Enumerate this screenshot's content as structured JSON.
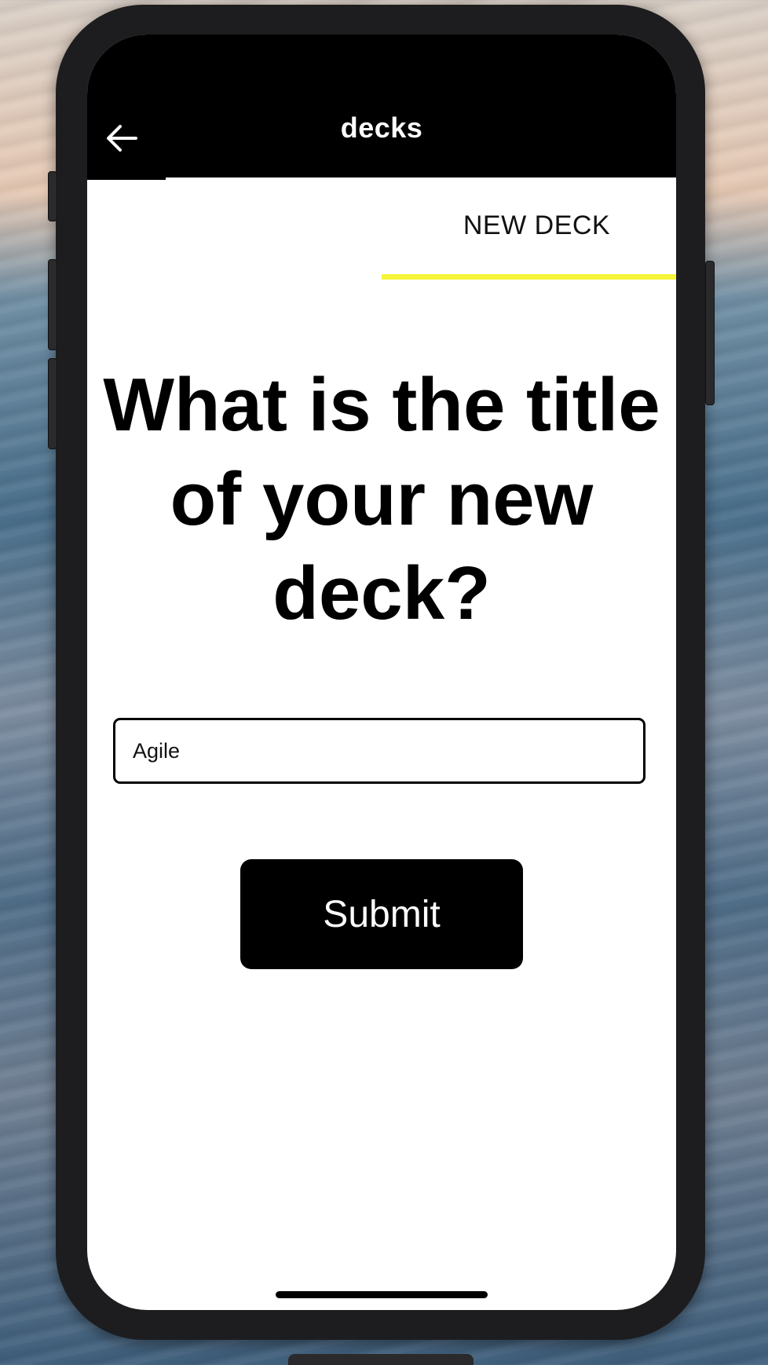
{
  "header": {
    "title": "decks",
    "back_icon": "arrow-left-icon"
  },
  "tabs": [
    {
      "label": "NEW DECK",
      "active": true
    }
  ],
  "colors": {
    "tab_indicator": "#f5f53b",
    "header_bg": "#000000",
    "button_bg": "#000000"
  },
  "main": {
    "question": "What is the title of your new deck?",
    "title_input": {
      "value": "Agile",
      "placeholder": ""
    },
    "submit_label": "Submit"
  }
}
